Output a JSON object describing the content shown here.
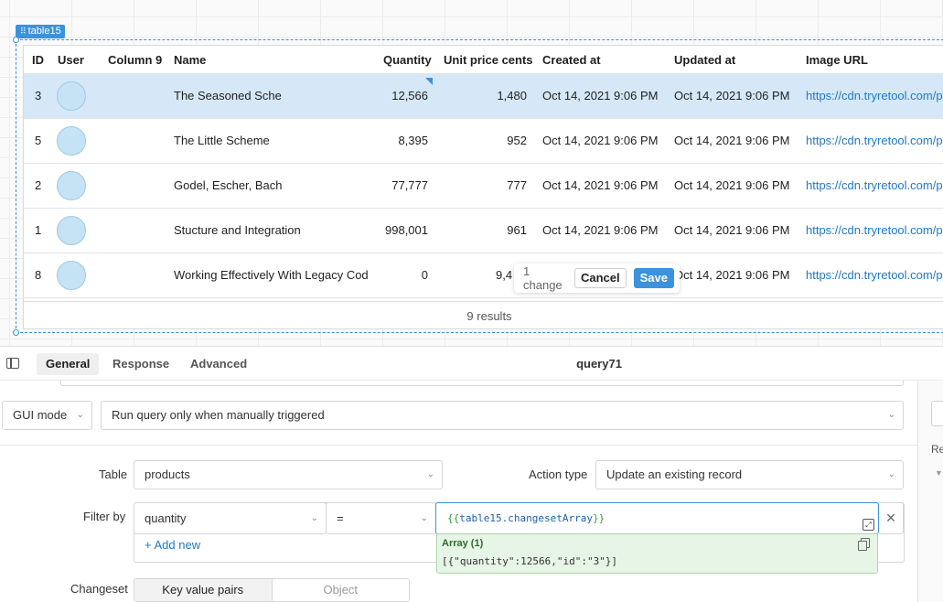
{
  "component": {
    "name": "table15"
  },
  "table": {
    "columns": [
      "ID",
      "User",
      "Column 9",
      "Name",
      "Quantity",
      "Unit price cents",
      "Created at",
      "Updated at",
      "Image URL"
    ],
    "rows": [
      {
        "id": "3",
        "name": "The Seasoned Sche",
        "quantity": "12,566",
        "unit_price": "1,480",
        "created": "Oct 14, 2021 9:06 PM",
        "updated": "Oct 14, 2021 9:06 PM",
        "url": "https://cdn.tryretool.com/p",
        "selected": true
      },
      {
        "id": "5",
        "name": "The Little Scheme",
        "quantity": "8,395",
        "unit_price": "952",
        "created": "Oct 14, 2021 9:06 PM",
        "updated": "Oct 14, 2021 9:06 PM",
        "url": "https://cdn.tryretool.com/p"
      },
      {
        "id": "2",
        "name": "Godel, Escher, Bach",
        "quantity": "77,777",
        "unit_price": "777",
        "created": "Oct 14, 2021 9:06 PM",
        "updated": "Oct 14, 2021 9:06 PM",
        "url": "https://cdn.tryretool.com/p"
      },
      {
        "id": "1",
        "name": "Stucture and Integration",
        "quantity": "998,001",
        "unit_price": "961",
        "created": "Oct 14, 2021 9:06 PM",
        "updated": "Oct 14, 2021 9:06 PM",
        "url": "https://cdn.tryretool.com/p"
      },
      {
        "id": "8",
        "name": "Working Effectively With Legacy Cod",
        "quantity": "0",
        "unit_price": "9,4",
        "created": "",
        "updated": "Oct 14, 2021 9:06 PM",
        "url": "https://cdn.tryretool.com/p"
      }
    ],
    "footer": "9 results",
    "changes": {
      "count_label": "1 change",
      "cancel_label": "Cancel",
      "save_label": "Save"
    }
  },
  "panel": {
    "tabs": [
      "General",
      "Response",
      "Advanced"
    ],
    "active_tab": "General",
    "query_name": "query71"
  },
  "query": {
    "mode": "GUI mode",
    "trigger": "Run query only when manually triggered",
    "table_label": "Table",
    "table_value": "products",
    "action_label": "Action type",
    "action_value": "Update an existing record",
    "filter_label": "Filter by",
    "filter_column": "quantity",
    "filter_operator": "=",
    "filter_value_prefix": "{{",
    "filter_value_var": "table15.changesetArray",
    "filter_value_suffix": "}}",
    "add_new": "+ Add new",
    "result_title": "Array (1)",
    "result_body": "[{\"quantity\":12566,\"id\":\"3\"}]",
    "changeset_label": "Changeset",
    "changeset_options": [
      "Key value pairs",
      "Object"
    ],
    "changeset_active": "Key value pairs"
  },
  "right_rail": {
    "text": "Re"
  },
  "colors": {
    "accent": "#3c92dc",
    "selected_row": "#d6e8f7",
    "link": "#1f78c8",
    "success_bg": "#e6f5e6"
  }
}
